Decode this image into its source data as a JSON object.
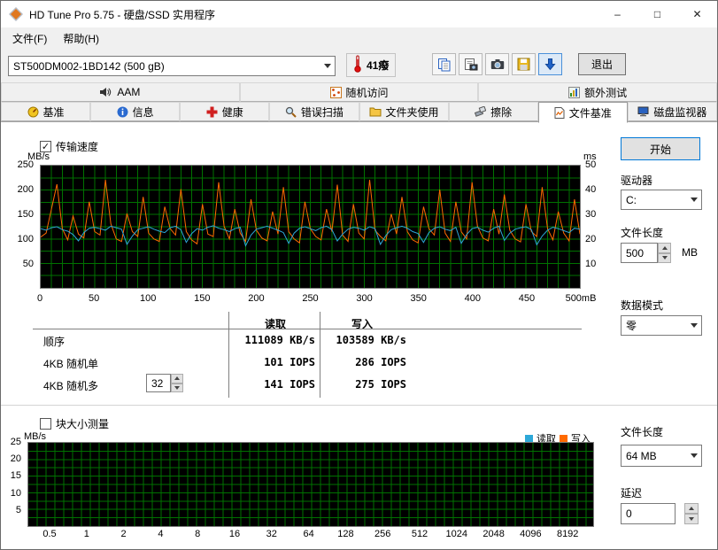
{
  "window": {
    "title": "HD Tune Pro 5.75 - 硬盘/SSD 实用程序",
    "minimize": "–",
    "maximize": "□",
    "close": "✕"
  },
  "menu": {
    "items": [
      {
        "name": "menu-file",
        "label": "文件(F)"
      },
      {
        "name": "menu-help",
        "label": "帮助(H)"
      }
    ]
  },
  "toolbar": {
    "drive_selector": "ST500DM002-1BD142 (500 gB)",
    "temperature": "41癈",
    "buttons": [
      {
        "name": "copy-button",
        "icon": "copy-icon",
        "highlighted": false
      },
      {
        "name": "screenshot-button",
        "icon": "screenshot-icon",
        "highlighted": false
      },
      {
        "name": "camera-button",
        "icon": "camera-icon",
        "highlighted": false
      },
      {
        "name": "save-button",
        "icon": "save-icon",
        "highlighted": false
      },
      {
        "name": "download-button",
        "icon": "download-icon",
        "highlighted": true
      }
    ],
    "exit_label": "退出"
  },
  "tabs": {
    "row1": [
      {
        "name": "tab-aam",
        "label": "AAM",
        "icon": "speaker-icon",
        "active": false
      },
      {
        "name": "tab-random-access",
        "label": "随机访问",
        "icon": "random-access-icon",
        "active": false
      },
      {
        "name": "tab-extra-tests",
        "label": "额外测试",
        "icon": "extra-tests-icon",
        "active": false
      }
    ],
    "row2": [
      {
        "name": "tab-benchmark",
        "label": "基准",
        "icon": "benchmark-icon",
        "active": false
      },
      {
        "name": "tab-info",
        "label": "信息",
        "icon": "info-icon",
        "active": false
      },
      {
        "name": "tab-health",
        "label": "健康",
        "icon": "health-icon",
        "active": false
      },
      {
        "name": "tab-error-scan",
        "label": "错误扫描",
        "icon": "error-scan-icon",
        "active": false
      },
      {
        "name": "tab-folder-usage",
        "label": "文件夹使用",
        "icon": "folder-usage-icon",
        "active": false
      },
      {
        "name": "tab-erase",
        "label": "擦除",
        "icon": "erase-icon",
        "active": false
      },
      {
        "name": "tab-file-benchmark",
        "label": "文件基准",
        "icon": "file-benchmark-icon",
        "active": true
      },
      {
        "name": "tab-disk-monitor",
        "label": "磁盘监视器",
        "icon": "disk-monitor-icon",
        "active": false
      }
    ]
  },
  "file_benchmark": {
    "transfer_speed_label": "传输速度",
    "transfer_speed_checked": true,
    "results": {
      "col_read": "读取",
      "col_write": "写入",
      "rows": [
        {
          "label": "顺序",
          "read": "111089 KB/s",
          "write": "103589 KB/s"
        },
        {
          "label": "4KB 随机单",
          "read": "101 IOPS",
          "write": "286 IOPS"
        },
        {
          "label": "4KB 随机多",
          "read": "141 IOPS",
          "write": "275 IOPS",
          "spinner": "32"
        }
      ]
    },
    "block_size_label": "块大小测量",
    "block_size_checked": false,
    "legend": {
      "read": "读取",
      "write": "写入"
    }
  },
  "sidebar": {
    "start_label": "开始",
    "drive_label": "驱动器",
    "drive_value": "C:",
    "file_length_label": "文件长度",
    "file_length_value": "500",
    "file_length_unit": "MB",
    "data_mode_label": "数据模式",
    "data_mode_value": "零",
    "file_length2_label": "文件长度",
    "file_length2_value": "64 MB",
    "delay_label": "延迟",
    "delay_value": "0"
  },
  "colors": {
    "accent": "#0078d7",
    "chart_bg": "#000000",
    "chart_grid": "#007200",
    "read": "#2da8d8",
    "write": "#ff6a00"
  },
  "chart_data": [
    {
      "type": "line",
      "title": "传输速度",
      "ylabel_left": "MB/s",
      "ylabel_right": "ms",
      "ylim_left": [
        0,
        250
      ],
      "ylim_right": [
        0,
        50
      ],
      "yticks_left": [
        250,
        200,
        150,
        100,
        50
      ],
      "yticks_right": [
        50,
        40,
        30,
        20,
        10
      ],
      "xlim": [
        0,
        500
      ],
      "x_step": 5,
      "xticks": [
        "0",
        "50",
        "100",
        "150",
        "200",
        "250",
        "300",
        "350",
        "400",
        "450",
        "500mB"
      ],
      "grid": true,
      "grid_color": "#007200",
      "background": "#000000",
      "series": [
        {
          "name": "写入",
          "color": "#ff6a00",
          "values": [
            104,
            112,
            162,
            212,
            121,
            98,
            147,
            110,
            102,
            176,
            115,
            108,
            221,
            131,
            100,
            95,
            152,
            115,
            105,
            186,
            112,
            100,
            95,
            166,
            121,
            108,
            202,
            115,
            98,
            90,
            171,
            110,
            105,
            216,
            126,
            100,
            161,
            112,
            95,
            181,
            118,
            102,
            96,
            156,
            110,
            206,
            115,
            100,
            92,
            176,
            121,
            105,
            98,
            161,
            115,
            211,
            108,
            95,
            171,
            112,
            100,
            221,
            118,
            105,
            96,
            151,
            110,
            186,
            115,
            98,
            92,
            166,
            121,
            108,
            201,
            112,
            95,
            176,
            115,
            100,
            216,
            126,
            102,
            96,
            161,
            110,
            191,
            118,
            100,
            94,
            171,
            115,
            105,
            206,
            121,
            98,
            156,
            112,
            96,
            181,
            110
          ]
        },
        {
          "name": "读取",
          "color": "#2da8d8",
          "values": [
            121,
            118,
            123,
            125,
            119,
            116,
            109,
            96,
            113,
            122,
            124,
            121,
            118,
            126,
            123,
            120,
            89,
            106,
            119,
            122,
            125,
            120,
            116,
            113,
            123,
            126,
            119,
            93,
            111,
            121,
            118,
            124,
            127,
            122,
            119,
            115,
            121,
            124,
            86,
            108,
            120,
            123,
            126,
            122,
            118,
            113,
            91,
            112,
            122,
            125,
            121,
            117,
            123,
            126,
            119,
            96,
            110,
            120,
            124,
            122,
            118,
            125,
            121,
            89,
            107,
            119,
            123,
            126,
            122,
            115,
            111,
            93,
            113,
            122,
            125,
            120,
            117,
            124,
            91,
            109,
            121,
            124,
            118,
            114,
            122,
            126,
            97,
            112,
            120,
            123,
            125,
            119,
            88,
            106,
            118,
            124,
            121,
            117,
            113,
            122,
            120
          ]
        }
      ]
    },
    {
      "type": "line",
      "title": "块大小测量",
      "ylabel": "MB/s",
      "ylim": [
        0,
        25
      ],
      "yticks": [
        25,
        20,
        15,
        10,
        5
      ],
      "xticks": [
        "0.5",
        "1",
        "2",
        "4",
        "8",
        "16",
        "32",
        "64",
        "128",
        "256",
        "512",
        "1024",
        "2048",
        "4096",
        "8192"
      ],
      "grid": true,
      "grid_color": "#007200",
      "background": "#000000",
      "legend": [
        "读取",
        "写入"
      ],
      "series": []
    }
  ]
}
